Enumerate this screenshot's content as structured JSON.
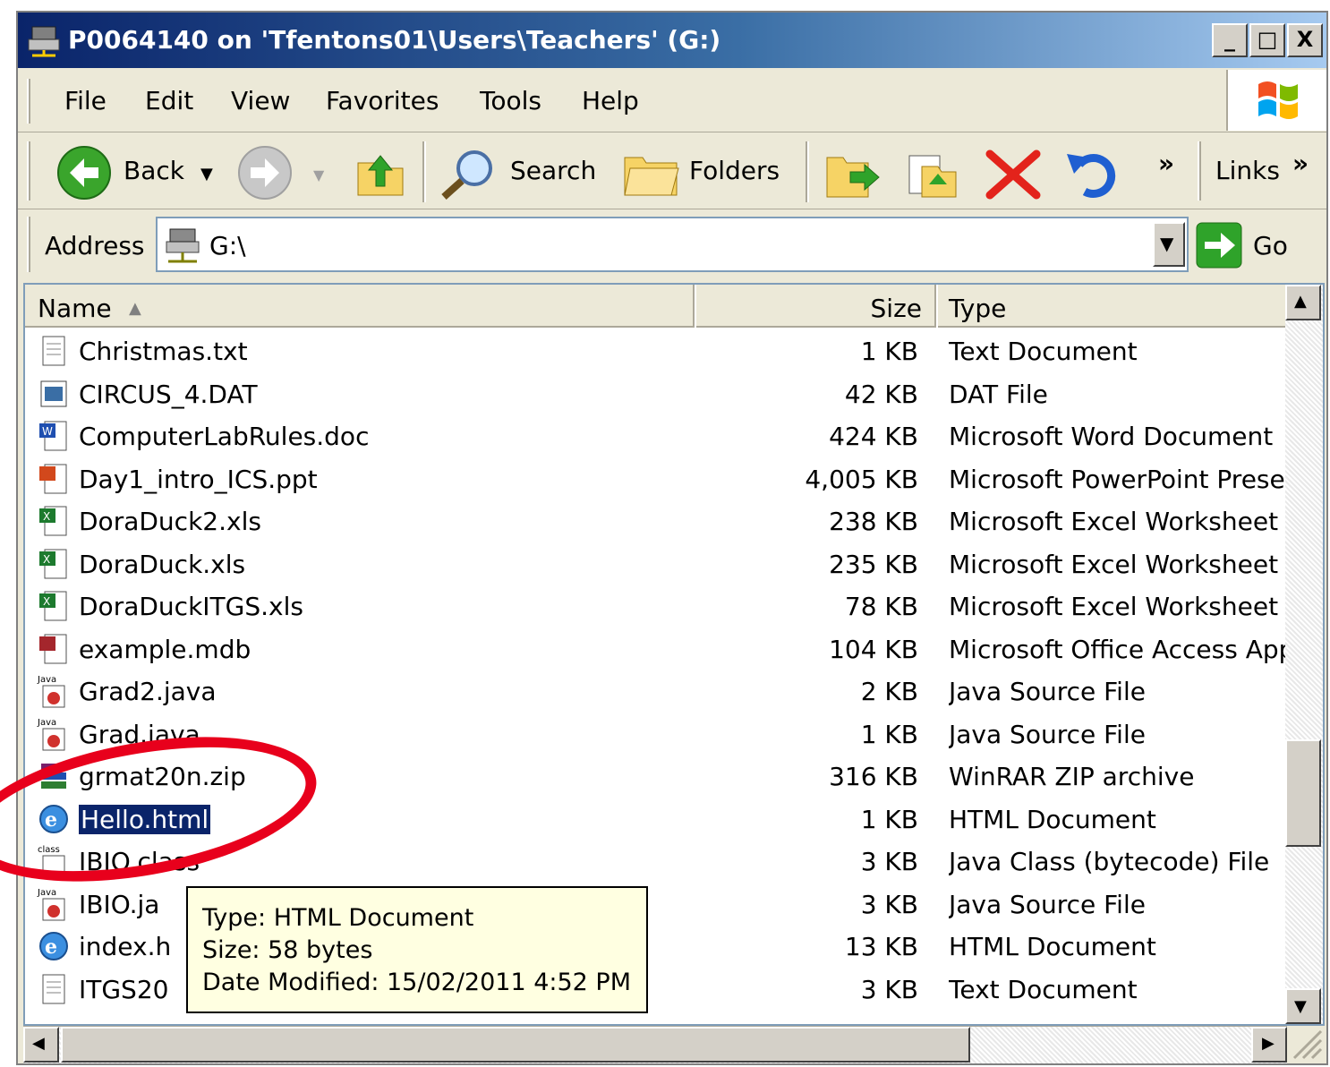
{
  "window": {
    "title": "P0064140 on 'Tfentons01\\Users\\Teachers' (G:)",
    "controls": {
      "minimize": "_",
      "maximize": "□",
      "close": "X"
    }
  },
  "menu": {
    "file": "File",
    "edit": "Edit",
    "view": "View",
    "favorites": "Favorites",
    "tools": "Tools",
    "help": "Help"
  },
  "toolbar": {
    "back": "Back",
    "search": "Search",
    "folders": "Folders",
    "chevron": "»",
    "links": "Links"
  },
  "address": {
    "label": "Address",
    "value": "G:\\",
    "go": "Go"
  },
  "columns": {
    "name": "Name",
    "size": "Size",
    "type": "Type"
  },
  "files": [
    {
      "name": "Christmas.txt",
      "size": "1 KB",
      "type": "Text Document",
      "icon": "text-file-icon"
    },
    {
      "name": "CIRCUS_4.DAT",
      "size": "42 KB",
      "type": "DAT File",
      "icon": "dat-file-icon"
    },
    {
      "name": "ComputerLabRules.doc",
      "size": "424 KB",
      "type": "Microsoft Word Document",
      "icon": "word-doc-icon"
    },
    {
      "name": "Day1_intro_ICS.ppt",
      "size": "4,005 KB",
      "type": "Microsoft PowerPoint Presen",
      "icon": "powerpoint-icon"
    },
    {
      "name": "DoraDuck2.xls",
      "size": "238 KB",
      "type": "Microsoft Excel Worksheet",
      "icon": "excel-icon"
    },
    {
      "name": "DoraDuck.xls",
      "size": "235 KB",
      "type": "Microsoft Excel Worksheet",
      "icon": "excel-icon"
    },
    {
      "name": "DoraDuckITGS.xls",
      "size": "78 KB",
      "type": "Microsoft Excel Worksheet",
      "icon": "excel-icon"
    },
    {
      "name": "example.mdb",
      "size": "104 KB",
      "type": "Microsoft Office Access App",
      "icon": "access-icon"
    },
    {
      "name": "Grad2.java",
      "size": "2 KB",
      "type": "Java Source File",
      "icon": "java-icon"
    },
    {
      "name": "Grad.java",
      "size": "1 KB",
      "type": "Java Source File",
      "icon": "java-icon"
    },
    {
      "name": "grmat20n.zip",
      "size": "316 KB",
      "type": "WinRAR ZIP archive",
      "icon": "winrar-icon"
    },
    {
      "name": "Hello.html",
      "size": "1 KB",
      "type": "HTML Document",
      "icon": "ie-html-icon",
      "selected": true
    },
    {
      "name": "IBIO.class",
      "size": "3 KB",
      "type": "Java Class (bytecode) File",
      "icon": "java-class-icon"
    },
    {
      "name": "IBIO.ja",
      "size": "3 KB",
      "type": "Java Source File",
      "icon": "java-icon"
    },
    {
      "name": "index.h",
      "size": "13 KB",
      "type": "HTML Document",
      "icon": "ie-html-icon"
    },
    {
      "name": "ITGS20",
      "size": "3 KB",
      "type": "Text Document",
      "icon": "text-file-icon"
    }
  ],
  "tooltip": {
    "type_line": "Type: HTML Document",
    "size_line": "Size: 58 bytes",
    "date_line": "Date Modified: 15/02/2011 4:52 PM"
  }
}
